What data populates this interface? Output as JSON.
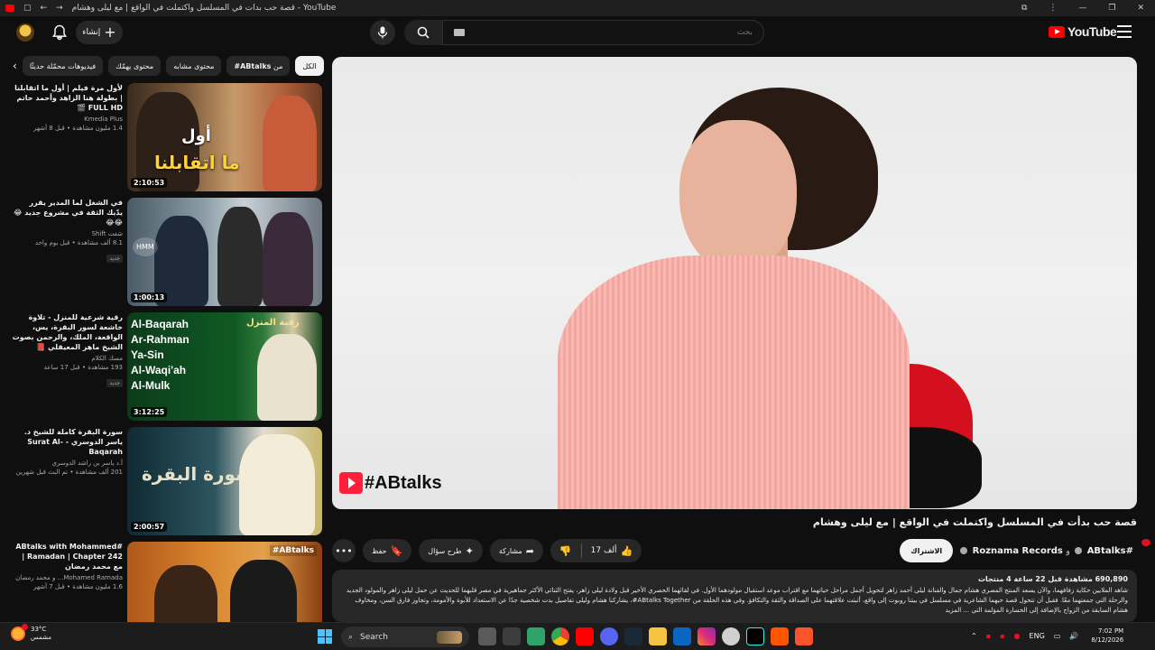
{
  "browser": {
    "title": "قصة حب بدأت في المسلسل واكتملت في الواقع | مع ليلى وهشام - YouTube"
  },
  "masthead": {
    "create_label": "إنشاء",
    "search_placeholder": "بحث",
    "logo_text": "YouTube"
  },
  "chips": [
    {
      "label": "الكل",
      "active": true
    },
    {
      "label_prefix": "من",
      "label_strong": "#ABtalks",
      "active": false
    },
    {
      "label": "محتوى مشابه",
      "active": false
    },
    {
      "label": "محتوى يهمّك",
      "active": false
    },
    {
      "label": "فيديوهات محمّلة حديثًا",
      "active": false
    }
  ],
  "recommendations": [
    {
      "title": "لأول مرة فيلم | أول ما اتقابلنا | بطولة هنا الزاهد وأحمد حاتم FULL HD 🎬",
      "channel": "Kmedia Plus",
      "stats": "1.4 مليون مشاهدة • قبل 8 أشهر",
      "duration": "2:10:53",
      "thumb_lines": [
        "أول",
        "ما اتقابلنا"
      ]
    },
    {
      "title": "في الشغل لما المدير يقرر يدّيك الثقة في مشروع جديد 😂😂😂",
      "channel": "شفت Shift",
      "stats": "8.1 ألف مشاهدة • قبل يوم واحد",
      "badge": "جديد",
      "duration": "1:00:13",
      "thumb_text": "HMM"
    },
    {
      "title": "رقية شرعية للمنزل - تلاوة خاشعة لسور البقرة، يس، الواقعة، الملك، والرحمن بصوت الشيخ ماهر المعيقلي 📕",
      "channel": "مسك الكلام",
      "stats": "193 مشاهدة • قبل 17 ساعة",
      "badge": "جديد",
      "duration": "3:12:25",
      "thumb_lines": [
        "Al-Baqarah",
        "Ar-Rahman",
        "Ya-Sin",
        "Al-Waqi'ah",
        "Al-Mulk"
      ],
      "thumb_title": "رقية المنزل"
    },
    {
      "title": "سورة البقرة كاملة للشيخ د. ياسر الدوسري - Surat Al-Baqarah",
      "channel": "أ.د ياسر بن راشد الدوسري",
      "stats": "201 ألف مشاهدة • تم البث قبل شهرين",
      "duration": "2:00:57",
      "thumb_title": "سورة البقرة"
    },
    {
      "title": "#ABtalks with Mohammed Ramadan | Chapter 242 | مع محمد رمضان",
      "channel": "Mohamed Ramada... و محمد رمضان",
      "stats": "1.6 مليون مشاهدة • قبل 7 أشهر",
      "thumb_tag": "#ABtalks"
    }
  ],
  "player": {
    "watermark": "#ABtalks"
  },
  "video": {
    "title": "قصة حب بدأت في المسلسل واكتملت في الواقع | مع ليلى وهشام",
    "channel_1": "#ABtalks",
    "channel_joiner": "و",
    "channel_2": "Roznama Records",
    "subscribe_label": "الاشتراك",
    "likes": "17 ألف",
    "share_label": "مشاركة",
    "ask_label": "طرح سؤال",
    "save_label": "حفظ",
    "stats": "690,890 مشاهدة قبل 22 ساعة 4 منتجات",
    "description": "شاهد الملايين حكاية زفافهما، والآن يسعد المنتج المصري هشام جمال والفنانة ليلى أحمد زاهر لتحويل أجمل مراحل حياتهما مع اقتراب موعد استقبال مولودهما الأول. في لقائهما الحصري الأخير قبل ولادة ليلى زاهر، يفتح الثنائي الأكثر جماهيرية في مصر قلبهما للحديث عن حمل ليلى زاهر والمولود الجديد والرحلة التي جمعتهما معًا. فقبل أن تتحول قصة حبهما الشاعرية في مسلسل في بيتنا روبوت إلى واقع، أثبتت علاقتهما على الصداقة والثقة والتكافؤ. وفي هذه الحلقة من ABtalks Together#، يشاركنا هشام وليلى تفاصيل بدت شخصية جدًا عن الاستعداد للأبوة والأمومة، وتجاوز فارق السن، ومخاوف هشام السابقة من الزواج بالإضافة إلى الخسارة المؤلمة التي ... المزيد"
  },
  "taskbar": {
    "temperature": "33°C",
    "condition": "مشمس",
    "search_label": "Search",
    "lang": "ENG",
    "time": "7:02 PM",
    "date": "8/12/2026"
  },
  "colors": {
    "background": "#0f0f0f",
    "brand_red": "#ff0000",
    "chip": "#272727",
    "chip_active": "#f1f1f1"
  }
}
